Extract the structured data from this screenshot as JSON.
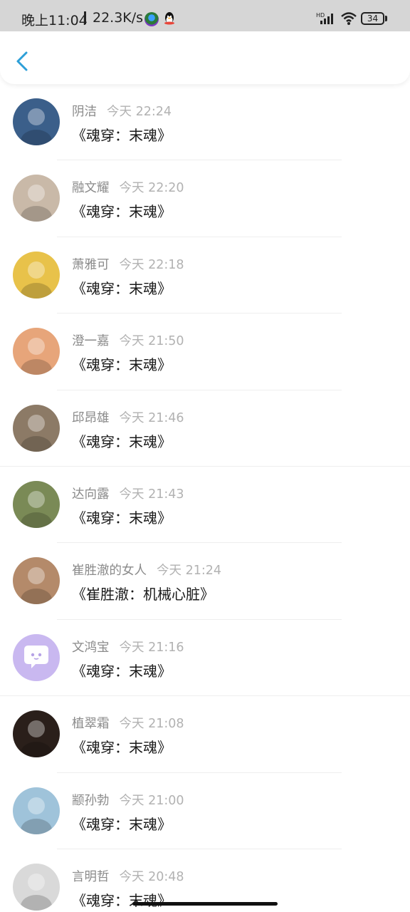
{
  "status_bar": {
    "time": "晚上11:04",
    "speed": "22.3K/s",
    "battery": "34"
  },
  "header": {
    "back_icon": "chevron-left-icon",
    "accent_color": "#2d9fd8"
  },
  "items": [
    {
      "name": "阴洁",
      "time": "今天 22:24",
      "title": "《魂穿：末魂》",
      "avatar_color": "#3b5f8a"
    },
    {
      "name": "融文耀",
      "time": "今天 22:20",
      "title": "《魂穿：末魂》",
      "avatar_color": "#c9b9a8"
    },
    {
      "name": "萧雅可",
      "time": "今天 22:18",
      "title": "《魂穿：末魂》",
      "avatar_color": "#e8c24a"
    },
    {
      "name": "澄一嘉",
      "time": "今天 21:50",
      "title": "《魂穿：末魂》",
      "avatar_color": "#e7a57a"
    },
    {
      "name": "邱昂雄",
      "time": "今天 21:46",
      "title": "《魂穿：末魂》",
      "avatar_color": "#8c7a66"
    },
    {
      "name": "达向露",
      "time": "今天 21:43",
      "title": "《魂穿：末魂》",
      "avatar_color": "#7a8a56"
    },
    {
      "name": "崔胜澈的女人",
      "time": "今天 21:24",
      "title": "《崔胜澈：机械心脏》",
      "avatar_color": "#b48a6a"
    },
    {
      "name": "文鸿宝",
      "time": "今天 21:16",
      "title": "《魂穿：末魂》",
      "avatar_color": "#c9b8f0"
    },
    {
      "name": "植翠霜",
      "time": "今天 21:08",
      "title": "《魂穿：末魂》",
      "avatar_color": "#2a1f1a"
    },
    {
      "name": "颛孙勃",
      "time": "今天 21:00",
      "title": "《魂穿：末魂》",
      "avatar_color": "#9fc3da"
    },
    {
      "name": "言明哲",
      "time": "今天 20:48",
      "title": "《魂穿：末魂》",
      "avatar_color": "#d9d9d9"
    }
  ]
}
